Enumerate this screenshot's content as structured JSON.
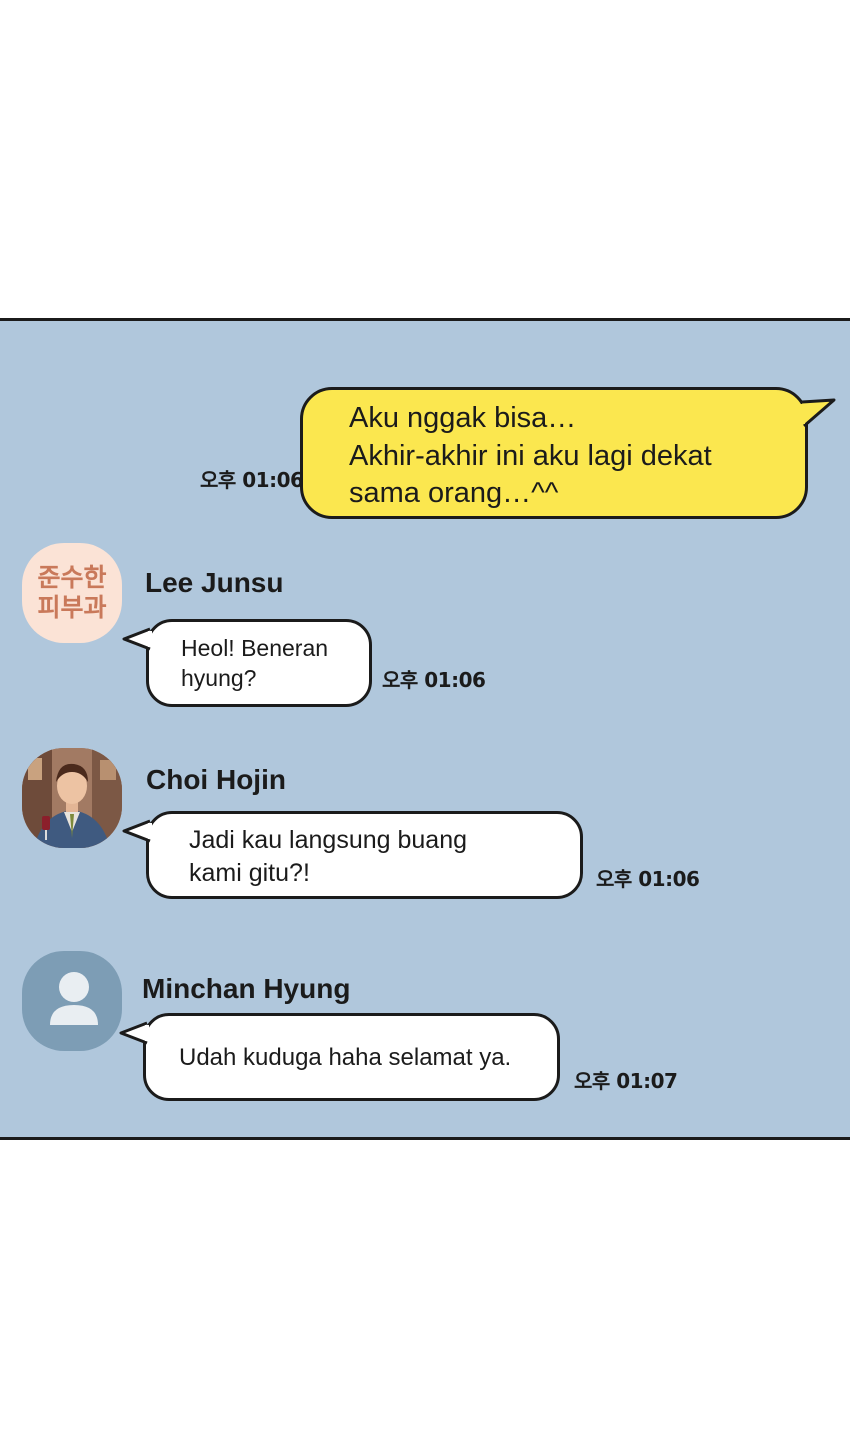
{
  "chat": {
    "my_message": {
      "lines": "Aku nggak bisa…\nAkhir-akhir ini aku lagi dekat\nsama orang…^^",
      "time": "오후 01:06"
    },
    "messages": [
      {
        "sender": "Lee Junsu",
        "avatar_text": "준수한\n피부과",
        "text": "Heol! Beneran\nhyung?",
        "time": "오후 01:06"
      },
      {
        "sender": "Choi Hojin",
        "avatar_icon": "man-in-suit-portrait",
        "text": "Jadi kau langsung buang\nkami gitu?!",
        "time": "오후 01:06"
      },
      {
        "sender": "Minchan Hyung",
        "avatar_icon": "default-person-icon",
        "text": "Udah kuduga haha selamat ya.",
        "time": "오후 01:07"
      }
    ]
  },
  "colors": {
    "chat_background": "#b0c7dc",
    "my_bubble": "#fbe74f",
    "other_bubble": "#ffffff",
    "border": "#1b1b1b",
    "avatar_junsu_bg": "#fbe3d6",
    "avatar_junsu_text": "#c9795a",
    "avatar_default_bg": "#7d9db5"
  }
}
